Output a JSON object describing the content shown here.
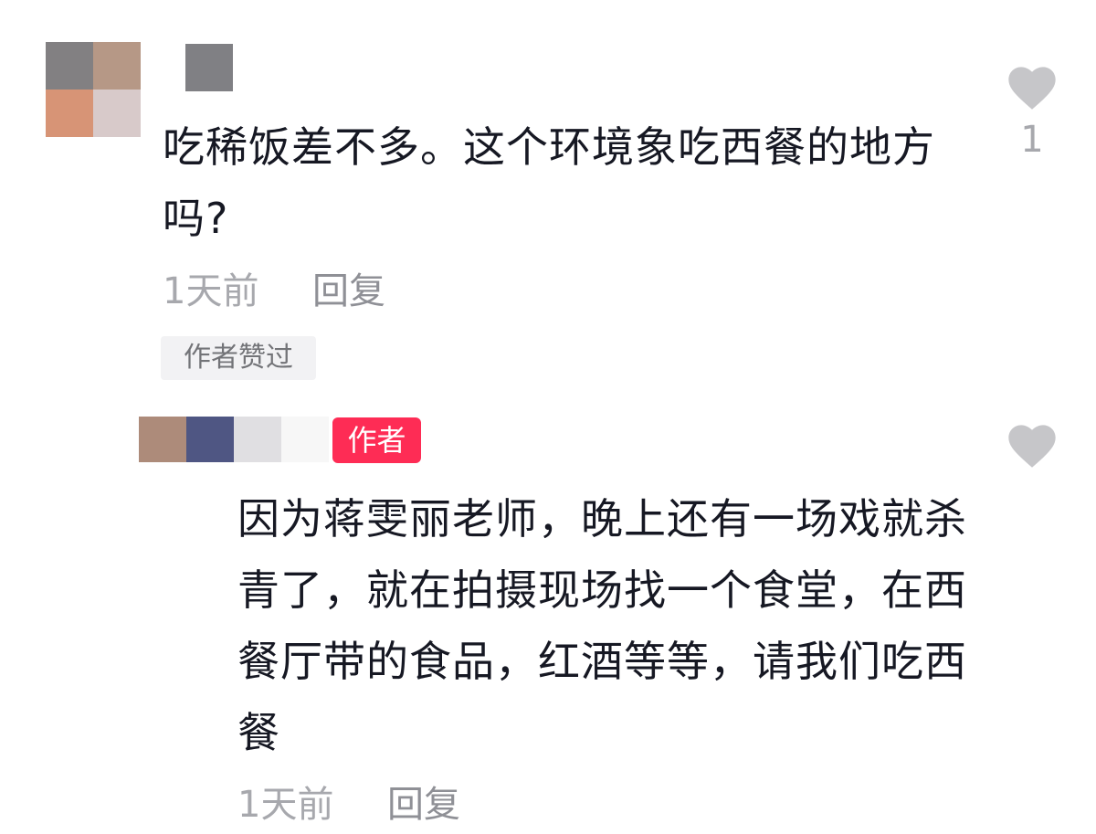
{
  "comment1": {
    "avatar_colors": [
      "#828082",
      "#b69886",
      "#d79476",
      "#d8caca"
    ],
    "name_color": "#808084",
    "text": "吃稀饭差不多。这个环境象吃西餐的地方吗?",
    "time": "1天前",
    "reply_label": "回复",
    "liked_badge": "作者赞过",
    "like_count": "1",
    "heart_icon": "heart-icon"
  },
  "comment2": {
    "name_colors": [
      "#ad8b7a",
      "#4f5683",
      "#e0dfe2",
      "#f7f7f7"
    ],
    "author_tag": "作者",
    "author_tag_color": "#fe2c55",
    "text": "因为蒋雯丽老师，晚上还有一场戏就杀青了，就在拍摄现场找一个食堂，在西餐厅带的食品，红酒等等，请我们吃西餐",
    "time": "1天前",
    "reply_label": "回复",
    "heart_icon": "heart-icon"
  }
}
